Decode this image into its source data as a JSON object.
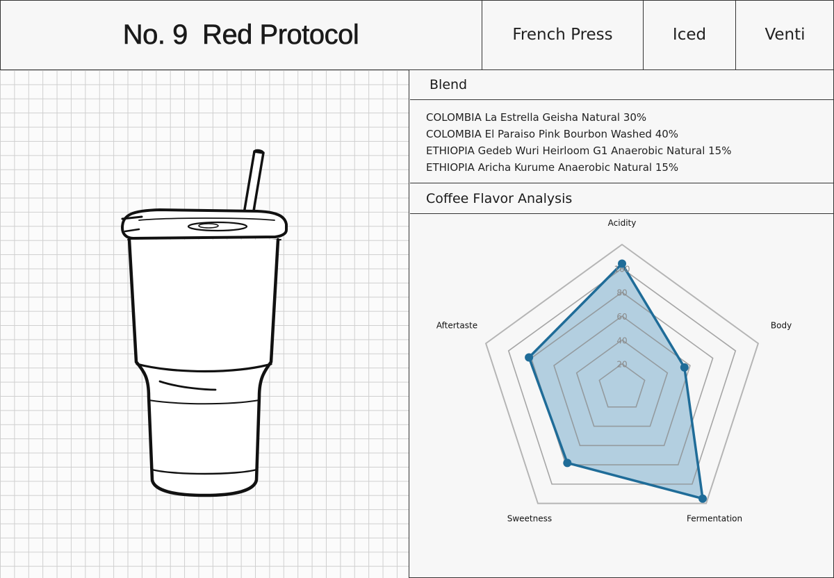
{
  "header": {
    "title": "No. 9  Red Protocol",
    "brew_method": "French Press",
    "temperature": "Iced",
    "size": "Venti"
  },
  "blend": {
    "heading": "Blend",
    "items": [
      "COLOMBIA La Estrella Geisha Natural 30%",
      "COLOMBIA El Paraiso Pink Bourbon Washed 40%",
      "ETHIOPIA Gedeb Wuri Heirloom G1 Anaerobic Natural 15%",
      "ETHIOPIA Aricha Kurume Anaerobic Natural 15%"
    ]
  },
  "flavor": {
    "heading": "Coffee Flavor Analysis"
  },
  "chart_data": {
    "type": "radar",
    "axes": [
      "Acidity",
      "Body",
      "Fermentation",
      "Sweetness",
      "Aftertaste"
    ],
    "values": [
      104,
      55,
      115,
      78,
      82
    ],
    "radial_ticks": [
      20,
      40,
      60,
      80,
      100
    ],
    "rmax": 120,
    "grid": true,
    "series_color": "#1f6c98",
    "fill_color": "#b3cfe0",
    "grid_color": "#8a8a8a",
    "outer_color": "#b5b5b5"
  },
  "colors": {
    "line": "#333333",
    "background": "#f7f7f7"
  }
}
